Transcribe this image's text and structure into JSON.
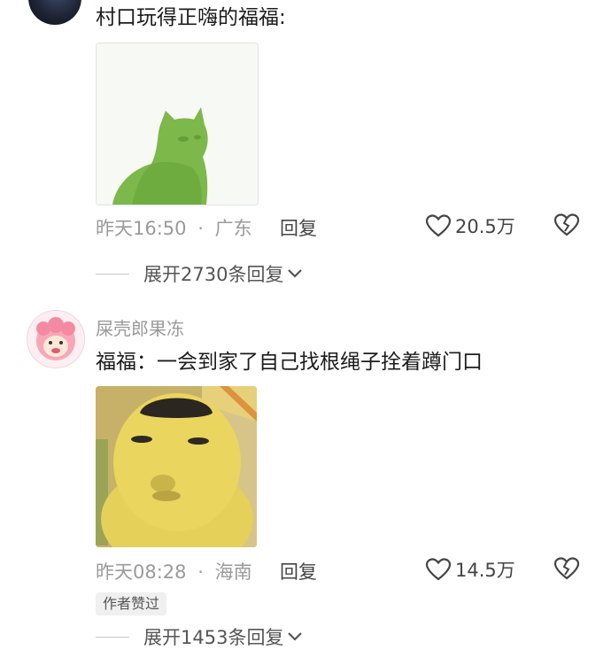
{
  "comments": [
    {
      "text": "村口玩得正嗨的福福:",
      "time": "昨天16:50",
      "location": "广东",
      "reply_label": "回复",
      "likes": "20.5万",
      "expand_label": "展开2730条回复"
    },
    {
      "username": "屎壳郎果冻",
      "text": "福福：一会到家了自己找根绳子拴着蹲门口",
      "time": "昨天08:28",
      "location": "海南",
      "reply_label": "回复",
      "likes": "14.5万",
      "author_badge": "作者赞过",
      "expand_label": "展开1453条回复"
    }
  ],
  "meta_separator": "·",
  "icons": {
    "like": "heart-outline-icon",
    "dislike": "broken-heart-icon",
    "expand": "chevron-down-icon"
  },
  "colors": {
    "text": "#1c1c1c",
    "meta": "#9a9a9a",
    "divider": "#c8c8c8"
  }
}
